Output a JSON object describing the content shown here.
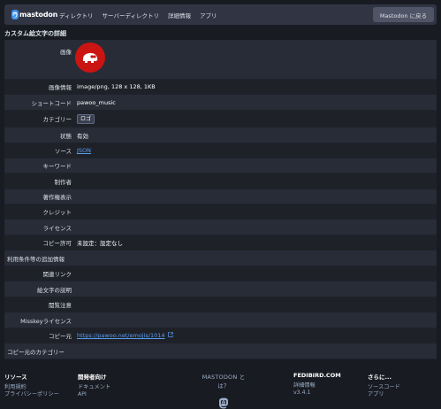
{
  "header": {
    "brand": "mastodon",
    "nav": [
      "ディレクトリ",
      "サーバーディレクトリ",
      "詳細情報",
      "アプリ"
    ],
    "back_button": "Mastodon に戻る"
  },
  "page_title": "カスタム絵文字の詳細",
  "details": {
    "image_label": "画像",
    "image_info_label": "画像情報",
    "image_info": "image/png, 128 x 128, 1KB",
    "shortcode_label": "ショートコード",
    "shortcode": "pawoo_music",
    "category_label": "カテゴリー",
    "category": "ロゴ",
    "status_label": "状態",
    "status": "有効",
    "source_label": "ソース",
    "source": "JSON",
    "keyword_label": "キーワード",
    "author_label": "制作者",
    "copyright_label": "著作権表示",
    "credit_label": "クレジット",
    "license_label": "ライセンス",
    "copy_permission_label": "コピー許可",
    "copy_permission": "未設定：設定なし",
    "usage_info_label": "利用条件等の追加情報",
    "related_link_label": "関連リンク",
    "description_label": "絵文字の説明",
    "sensitive_label": "閲覧注意",
    "misskey_license_label": "Misskeyライセンス",
    "copy_source_label": "コピー元",
    "copy_source": "https://pawoo.net/emojis/1014",
    "copy_source_category_label": "コピー元のカテゴリー"
  },
  "footer": {
    "resources": {
      "title": "リソース",
      "links": [
        "利用規約",
        "プライバシーポリシー"
      ]
    },
    "developers": {
      "title": "開発者向け",
      "links": [
        "ドキュメント",
        "API"
      ]
    },
    "about": {
      "title": "MASTODON とは？"
    },
    "server": {
      "title": "FEDIBIRD.COM",
      "links": [
        "詳細情報",
        "v3.4.1"
      ]
    },
    "more": {
      "title": "さらに...",
      "links": [
        "ソースコード",
        "アプリ"
      ]
    }
  },
  "colors": {
    "accent": "#3c94ec",
    "link": "#5a9ded",
    "emoji_bg": "#ca1512"
  },
  "icons": {
    "brand": "mastodon-logo-icon",
    "external": "external-link-icon",
    "footer": "mastodon-icon"
  }
}
